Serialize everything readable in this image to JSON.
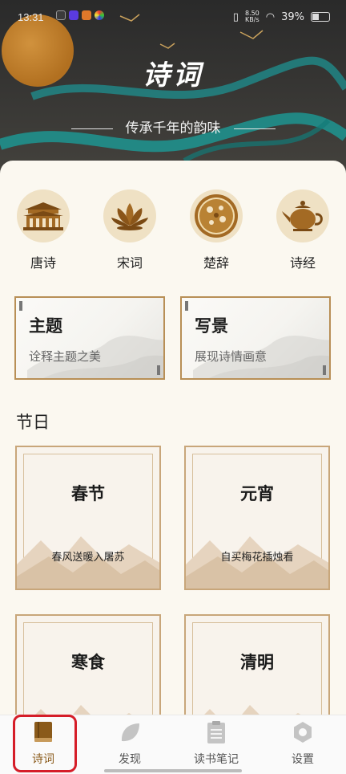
{
  "status_bar": {
    "time": "13:31",
    "net_speed_value": "8.50",
    "net_speed_unit": "KB/s",
    "battery": "39%"
  },
  "hero": {
    "title": "诗词",
    "subtitle": "传承千年的韵味"
  },
  "categories": [
    {
      "label": "唐诗",
      "icon": "pagoda-icon"
    },
    {
      "label": "宋词",
      "icon": "lotus-icon"
    },
    {
      "label": "楚辞",
      "icon": "plate-icon"
    },
    {
      "label": "诗经",
      "icon": "teapot-icon"
    }
  ],
  "theme_cards": [
    {
      "title": "主题",
      "subtitle": "诠释主题之美"
    },
    {
      "title": "写景",
      "subtitle": "展现诗情画意"
    }
  ],
  "festival_section": {
    "title": "节日",
    "cards": [
      {
        "title": "春节",
        "subtitle": "春风送暖入屠苏"
      },
      {
        "title": "元宵",
        "subtitle": "自买梅花插烛看"
      },
      {
        "title": "寒食",
        "subtitle": ""
      },
      {
        "title": "清明",
        "subtitle": ""
      }
    ]
  },
  "bottom_nav": [
    {
      "label": "诗词",
      "icon": "book-icon",
      "active": true
    },
    {
      "label": "发现",
      "icon": "leaf-icon",
      "active": false
    },
    {
      "label": "读书笔记",
      "icon": "notes-icon",
      "active": false
    },
    {
      "label": "设置",
      "icon": "settings-icon",
      "active": false
    }
  ],
  "colors": {
    "accent": "#8a5a1a",
    "card_border": "#b88f56",
    "icon_bg": "#efe1c4",
    "highlight": "#d51d28"
  }
}
